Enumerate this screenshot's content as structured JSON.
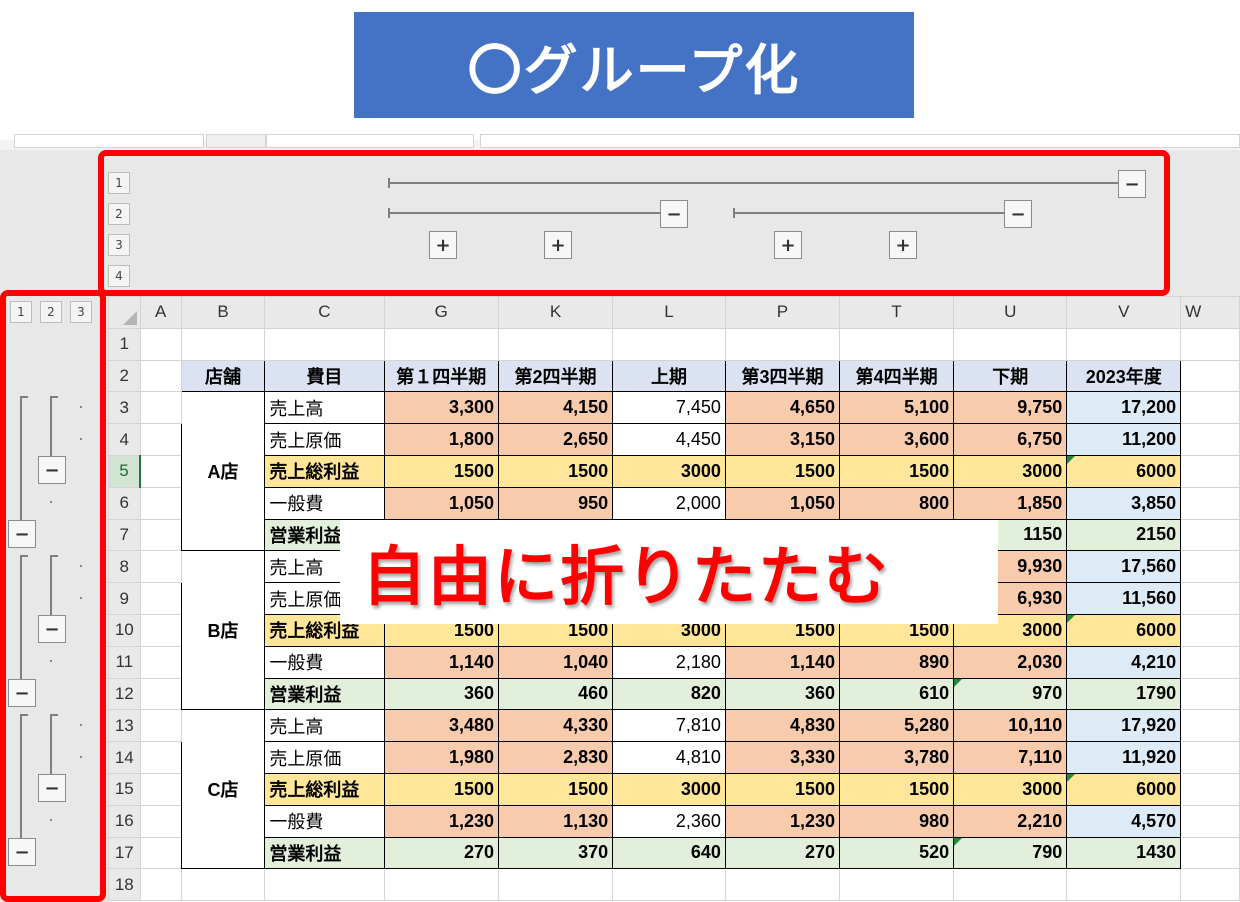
{
  "banner": {
    "title": "〇グループ化"
  },
  "callout": {
    "text": "自由に折りたたむ"
  },
  "outline": {
    "column_levels": [
      "1",
      "2",
      "3",
      "4"
    ],
    "row_levels": [
      "1",
      "2",
      "3"
    ],
    "expand_symbol": "+",
    "collapse_symbol": "−"
  },
  "columns": [
    "A",
    "B",
    "C",
    "G",
    "K",
    "L",
    "P",
    "T",
    "U",
    "V",
    "W"
  ],
  "row_numbers": [
    "1",
    "2",
    "3",
    "4",
    "5",
    "6",
    "7",
    "8",
    "9",
    "10",
    "11",
    "12",
    "13",
    "14",
    "15",
    "16",
    "17",
    "18"
  ],
  "table": {
    "headers": [
      "店舗",
      "費目",
      "第１四半期",
      "第2四半期",
      "上期",
      "第3四半期",
      "第4四半期",
      "下期",
      "2023年度"
    ],
    "stores": [
      "A店",
      "B店",
      "C店"
    ],
    "rows": [
      [
        "売上高",
        "3,300",
        "4,150",
        "7,450",
        "4,650",
        "5,100",
        "9,750",
        "17,200"
      ],
      [
        "売上原価",
        "1,800",
        "2,650",
        "4,450",
        "3,150",
        "3,600",
        "6,750",
        "11,200"
      ],
      [
        "売上総利益",
        "1500",
        "1500",
        "3000",
        "1500",
        "1500",
        "3000",
        "6000"
      ],
      [
        "一般費",
        "1,050",
        "950",
        "2,000",
        "1,050",
        "800",
        "1,850",
        "3,850"
      ],
      [
        "営業利益",
        "",
        "",
        "",
        "",
        "",
        "1150",
        "2150"
      ],
      [
        "売上高",
        "",
        "",
        "",
        "",
        "",
        "9,930",
        "17,560"
      ],
      [
        "売上原価",
        "",
        "",
        "",
        "",
        "",
        "6,930",
        "11,560"
      ],
      [
        "売上総利益",
        "1500",
        "1500",
        "3000",
        "1500",
        "1500",
        "3000",
        "6000"
      ],
      [
        "一般費",
        "1,140",
        "1,040",
        "2,180",
        "1,140",
        "890",
        "2,030",
        "4,210"
      ],
      [
        "営業利益",
        "360",
        "460",
        "820",
        "360",
        "610",
        "970",
        "1790"
      ],
      [
        "売上高",
        "3,480",
        "4,330",
        "7,810",
        "4,830",
        "5,280",
        "10,110",
        "17,920"
      ],
      [
        "売上原価",
        "1,980",
        "2,830",
        "4,810",
        "3,330",
        "3,780",
        "7,110",
        "11,920"
      ],
      [
        "売上総利益",
        "1500",
        "1500",
        "3000",
        "1500",
        "1500",
        "3000",
        "6000"
      ],
      [
        "一般費",
        "1,230",
        "1,130",
        "2,360",
        "1,230",
        "980",
        "2,210",
        "4,570"
      ],
      [
        "営業利益",
        "270",
        "370",
        "640",
        "270",
        "520",
        "790",
        "1430"
      ]
    ]
  },
  "colors": {
    "banner": "#4472c4",
    "frame": "#ff0000",
    "peach": "#f8cbad",
    "yellow": "#ffe699",
    "green": "#e2efda",
    "blue": "#ddebf7",
    "header": "#dbe3f3"
  }
}
